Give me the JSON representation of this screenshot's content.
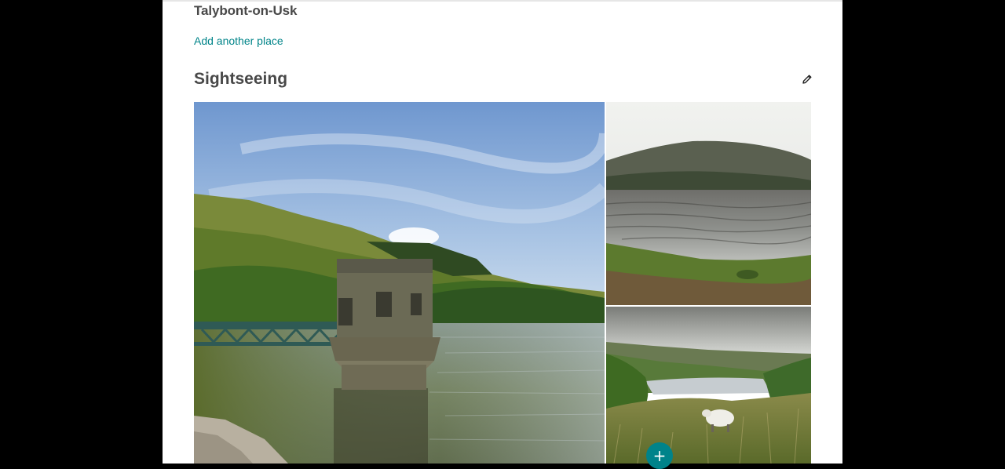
{
  "place": {
    "name": "Talybont-on-Usk"
  },
  "actions": {
    "add_place_label": "Add another place",
    "add_fab_glyph": "+"
  },
  "section": {
    "title": "Sightseeing",
    "edit_icon": "pencil-icon"
  },
  "gallery": {
    "photos": [
      {
        "id": "main",
        "subject": "Reservoir valve tower with bridge, lake and wooded hills"
      },
      {
        "id": "top-right",
        "subject": "Lake with hill in mist"
      },
      {
        "id": "bottom-right",
        "subject": "Sheep on grassy hillside above valley"
      }
    ]
  },
  "colors": {
    "accent": "#008489",
    "fab": "#00838a",
    "heading": "#484848",
    "backdrop": "#000000"
  }
}
